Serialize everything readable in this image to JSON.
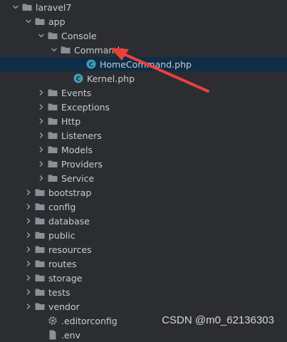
{
  "tree": [
    {
      "label": "laravel7",
      "depth": 0,
      "expand": "open",
      "icon": "folder-icon"
    },
    {
      "label": "app",
      "depth": 1,
      "expand": "open",
      "icon": "folder-icon"
    },
    {
      "label": "Console",
      "depth": 2,
      "expand": "open",
      "icon": "folder-icon"
    },
    {
      "label": "Commands",
      "depth": 3,
      "expand": "open",
      "icon": "folder-icon"
    },
    {
      "label": "HomeCommand.php",
      "depth": 5,
      "expand": "none",
      "icon": "php-class-icon",
      "selected": true
    },
    {
      "label": "Kernel.php",
      "depth": 4,
      "expand": "none",
      "icon": "php-class-icon"
    },
    {
      "label": "Events",
      "depth": 2,
      "expand": "closed",
      "icon": "folder-icon"
    },
    {
      "label": "Exceptions",
      "depth": 2,
      "expand": "closed",
      "icon": "folder-icon"
    },
    {
      "label": "Http",
      "depth": 2,
      "expand": "closed",
      "icon": "folder-icon"
    },
    {
      "label": "Listeners",
      "depth": 2,
      "expand": "closed",
      "icon": "folder-icon"
    },
    {
      "label": "Models",
      "depth": 2,
      "expand": "closed",
      "icon": "folder-icon"
    },
    {
      "label": "Providers",
      "depth": 2,
      "expand": "closed",
      "icon": "folder-icon"
    },
    {
      "label": "Service",
      "depth": 2,
      "expand": "closed",
      "icon": "folder-icon"
    },
    {
      "label": "bootstrap",
      "depth": 1,
      "expand": "closed",
      "icon": "folder-icon"
    },
    {
      "label": "config",
      "depth": 1,
      "expand": "closed",
      "icon": "folder-icon"
    },
    {
      "label": "database",
      "depth": 1,
      "expand": "closed",
      "icon": "folder-icon"
    },
    {
      "label": "public",
      "depth": 1,
      "expand": "closed",
      "icon": "folder-icon"
    },
    {
      "label": "resources",
      "depth": 1,
      "expand": "closed",
      "icon": "folder-icon"
    },
    {
      "label": "routes",
      "depth": 1,
      "expand": "closed",
      "icon": "folder-icon"
    },
    {
      "label": "storage",
      "depth": 1,
      "expand": "closed",
      "icon": "folder-icon"
    },
    {
      "label": "tests",
      "depth": 1,
      "expand": "closed",
      "icon": "folder-icon"
    },
    {
      "label": "vendor",
      "depth": 1,
      "expand": "closed",
      "icon": "folder-icon"
    },
    {
      "label": ".editorconfig",
      "depth": 2,
      "expand": "none",
      "icon": "gear-icon"
    },
    {
      "label": ".env",
      "depth": 2,
      "expand": "none",
      "icon": "file-icon"
    }
  ],
  "watermark": "CSDN @m0_62136303",
  "colors": {
    "background": "#2b2d30",
    "selection": "#0e2d47",
    "folder": "#8a8f99",
    "php_class": "#3f9fb5",
    "annotation_arrow": "#e8413c"
  }
}
